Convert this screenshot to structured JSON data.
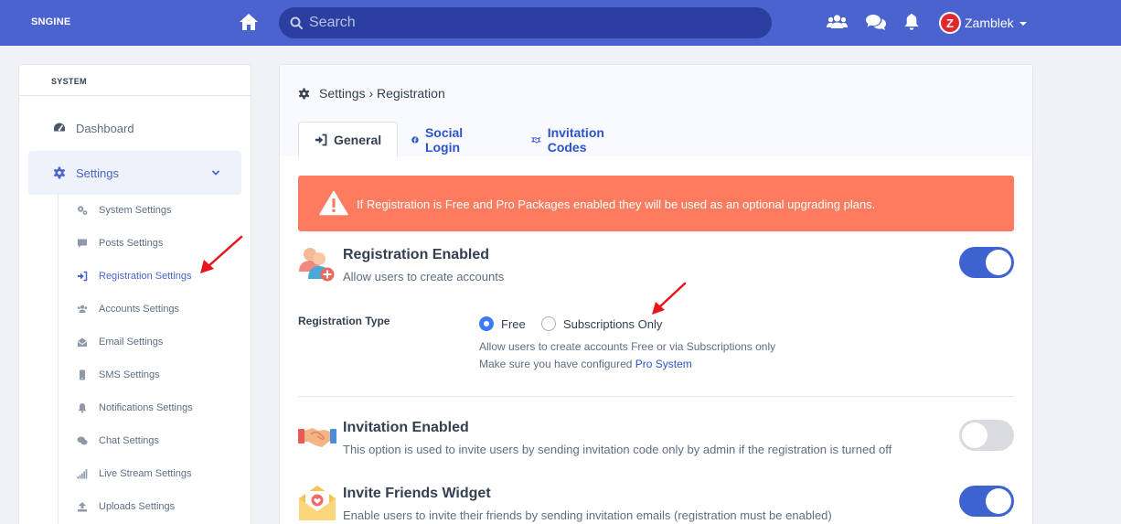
{
  "topbar": {
    "brand": "SNGINE",
    "search_placeholder": "Search",
    "user_initial": "Z",
    "user_name": "Zamblek"
  },
  "sidebar": {
    "header": "SYSTEM",
    "items": [
      {
        "label": "Dashboard",
        "icon": "dashboard-icon"
      },
      {
        "label": "Settings",
        "icon": "gear-icon",
        "expanded": true
      }
    ],
    "sub_items": [
      {
        "label": "System Settings",
        "icon": "gears-icon"
      },
      {
        "label": "Posts Settings",
        "icon": "comment-icon"
      },
      {
        "label": "Registration Settings",
        "icon": "sign-in-icon",
        "active": true
      },
      {
        "label": "Accounts Settings",
        "icon": "users-icon"
      },
      {
        "label": "Email Settings",
        "icon": "envelope-open-icon"
      },
      {
        "label": "SMS Settings",
        "icon": "mobile-icon"
      },
      {
        "label": "Notifications Settings",
        "icon": "bell-icon"
      },
      {
        "label": "Chat Settings",
        "icon": "comments-icon"
      },
      {
        "label": "Live Stream Settings",
        "icon": "signal-icon"
      },
      {
        "label": "Uploads Settings",
        "icon": "upload-icon"
      }
    ]
  },
  "main": {
    "breadcrumb": "Settings › Registration",
    "tabs": [
      {
        "label": "General",
        "icon": "sign-in-icon",
        "active": true
      },
      {
        "label": "Social Login",
        "icon": "facebook-icon"
      },
      {
        "label": "Invitation Codes",
        "icon": "handshake-icon"
      }
    ],
    "alert": "If Registration is Free and Pro Packages enabled they will be used as an optional upgrading plans.",
    "registration_enabled": {
      "title": "Registration Enabled",
      "desc": "Allow users to create accounts",
      "enabled": true
    },
    "registration_type": {
      "label": "Registration Type",
      "options": [
        "Free",
        "Subscriptions Only"
      ],
      "selected": "Free",
      "help_line1": "Allow users to create accounts Free or via Subscriptions only",
      "help_line2_prefix": "Make sure you have configured ",
      "help_link": "Pro System"
    },
    "invitation_enabled": {
      "title": "Invitation Enabled",
      "desc": "This option is used to invite users by sending invitation code only by admin if the registration is turned off",
      "enabled": false
    },
    "invite_friends": {
      "title": "Invite Friends Widget",
      "desc": "Enable users to invite their friends by sending invitation emails (registration must be enabled)",
      "enabled": true
    }
  },
  "colors": {
    "topbar": "#4a63cf",
    "accent": "#3d63d1",
    "alert": "#fd7b5f",
    "annotation_arrow": "#e8141c"
  }
}
